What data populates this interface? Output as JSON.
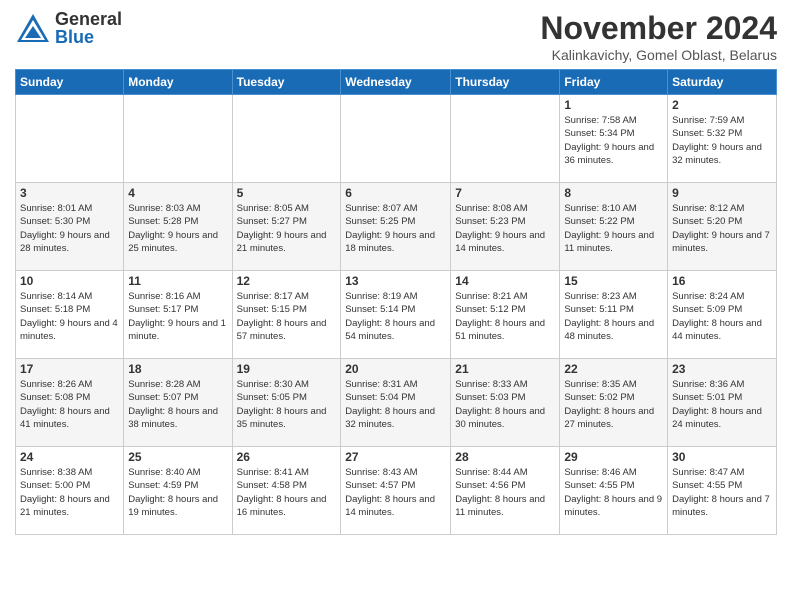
{
  "header": {
    "logo_general": "General",
    "logo_blue": "Blue",
    "month_title": "November 2024",
    "location": "Kalinkavichy, Gomel Oblast, Belarus"
  },
  "days_of_week": [
    "Sunday",
    "Monday",
    "Tuesday",
    "Wednesday",
    "Thursday",
    "Friday",
    "Saturday"
  ],
  "weeks": [
    [
      {
        "day": "",
        "info": ""
      },
      {
        "day": "",
        "info": ""
      },
      {
        "day": "",
        "info": ""
      },
      {
        "day": "",
        "info": ""
      },
      {
        "day": "",
        "info": ""
      },
      {
        "day": "1",
        "info": "Sunrise: 7:58 AM\nSunset: 5:34 PM\nDaylight: 9 hours and 36 minutes."
      },
      {
        "day": "2",
        "info": "Sunrise: 7:59 AM\nSunset: 5:32 PM\nDaylight: 9 hours and 32 minutes."
      }
    ],
    [
      {
        "day": "3",
        "info": "Sunrise: 8:01 AM\nSunset: 5:30 PM\nDaylight: 9 hours and 28 minutes."
      },
      {
        "day": "4",
        "info": "Sunrise: 8:03 AM\nSunset: 5:28 PM\nDaylight: 9 hours and 25 minutes."
      },
      {
        "day": "5",
        "info": "Sunrise: 8:05 AM\nSunset: 5:27 PM\nDaylight: 9 hours and 21 minutes."
      },
      {
        "day": "6",
        "info": "Sunrise: 8:07 AM\nSunset: 5:25 PM\nDaylight: 9 hours and 18 minutes."
      },
      {
        "day": "7",
        "info": "Sunrise: 8:08 AM\nSunset: 5:23 PM\nDaylight: 9 hours and 14 minutes."
      },
      {
        "day": "8",
        "info": "Sunrise: 8:10 AM\nSunset: 5:22 PM\nDaylight: 9 hours and 11 minutes."
      },
      {
        "day": "9",
        "info": "Sunrise: 8:12 AM\nSunset: 5:20 PM\nDaylight: 9 hours and 7 minutes."
      }
    ],
    [
      {
        "day": "10",
        "info": "Sunrise: 8:14 AM\nSunset: 5:18 PM\nDaylight: 9 hours and 4 minutes."
      },
      {
        "day": "11",
        "info": "Sunrise: 8:16 AM\nSunset: 5:17 PM\nDaylight: 9 hours and 1 minute."
      },
      {
        "day": "12",
        "info": "Sunrise: 8:17 AM\nSunset: 5:15 PM\nDaylight: 8 hours and 57 minutes."
      },
      {
        "day": "13",
        "info": "Sunrise: 8:19 AM\nSunset: 5:14 PM\nDaylight: 8 hours and 54 minutes."
      },
      {
        "day": "14",
        "info": "Sunrise: 8:21 AM\nSunset: 5:12 PM\nDaylight: 8 hours and 51 minutes."
      },
      {
        "day": "15",
        "info": "Sunrise: 8:23 AM\nSunset: 5:11 PM\nDaylight: 8 hours and 48 minutes."
      },
      {
        "day": "16",
        "info": "Sunrise: 8:24 AM\nSunset: 5:09 PM\nDaylight: 8 hours and 44 minutes."
      }
    ],
    [
      {
        "day": "17",
        "info": "Sunrise: 8:26 AM\nSunset: 5:08 PM\nDaylight: 8 hours and 41 minutes."
      },
      {
        "day": "18",
        "info": "Sunrise: 8:28 AM\nSunset: 5:07 PM\nDaylight: 8 hours and 38 minutes."
      },
      {
        "day": "19",
        "info": "Sunrise: 8:30 AM\nSunset: 5:05 PM\nDaylight: 8 hours and 35 minutes."
      },
      {
        "day": "20",
        "info": "Sunrise: 8:31 AM\nSunset: 5:04 PM\nDaylight: 8 hours and 32 minutes."
      },
      {
        "day": "21",
        "info": "Sunrise: 8:33 AM\nSunset: 5:03 PM\nDaylight: 8 hours and 30 minutes."
      },
      {
        "day": "22",
        "info": "Sunrise: 8:35 AM\nSunset: 5:02 PM\nDaylight: 8 hours and 27 minutes."
      },
      {
        "day": "23",
        "info": "Sunrise: 8:36 AM\nSunset: 5:01 PM\nDaylight: 8 hours and 24 minutes."
      }
    ],
    [
      {
        "day": "24",
        "info": "Sunrise: 8:38 AM\nSunset: 5:00 PM\nDaylight: 8 hours and 21 minutes."
      },
      {
        "day": "25",
        "info": "Sunrise: 8:40 AM\nSunset: 4:59 PM\nDaylight: 8 hours and 19 minutes."
      },
      {
        "day": "26",
        "info": "Sunrise: 8:41 AM\nSunset: 4:58 PM\nDaylight: 8 hours and 16 minutes."
      },
      {
        "day": "27",
        "info": "Sunrise: 8:43 AM\nSunset: 4:57 PM\nDaylight: 8 hours and 14 minutes."
      },
      {
        "day": "28",
        "info": "Sunrise: 8:44 AM\nSunset: 4:56 PM\nDaylight: 8 hours and 11 minutes."
      },
      {
        "day": "29",
        "info": "Sunrise: 8:46 AM\nSunset: 4:55 PM\nDaylight: 8 hours and 9 minutes."
      },
      {
        "day": "30",
        "info": "Sunrise: 8:47 AM\nSunset: 4:55 PM\nDaylight: 8 hours and 7 minutes."
      }
    ]
  ]
}
